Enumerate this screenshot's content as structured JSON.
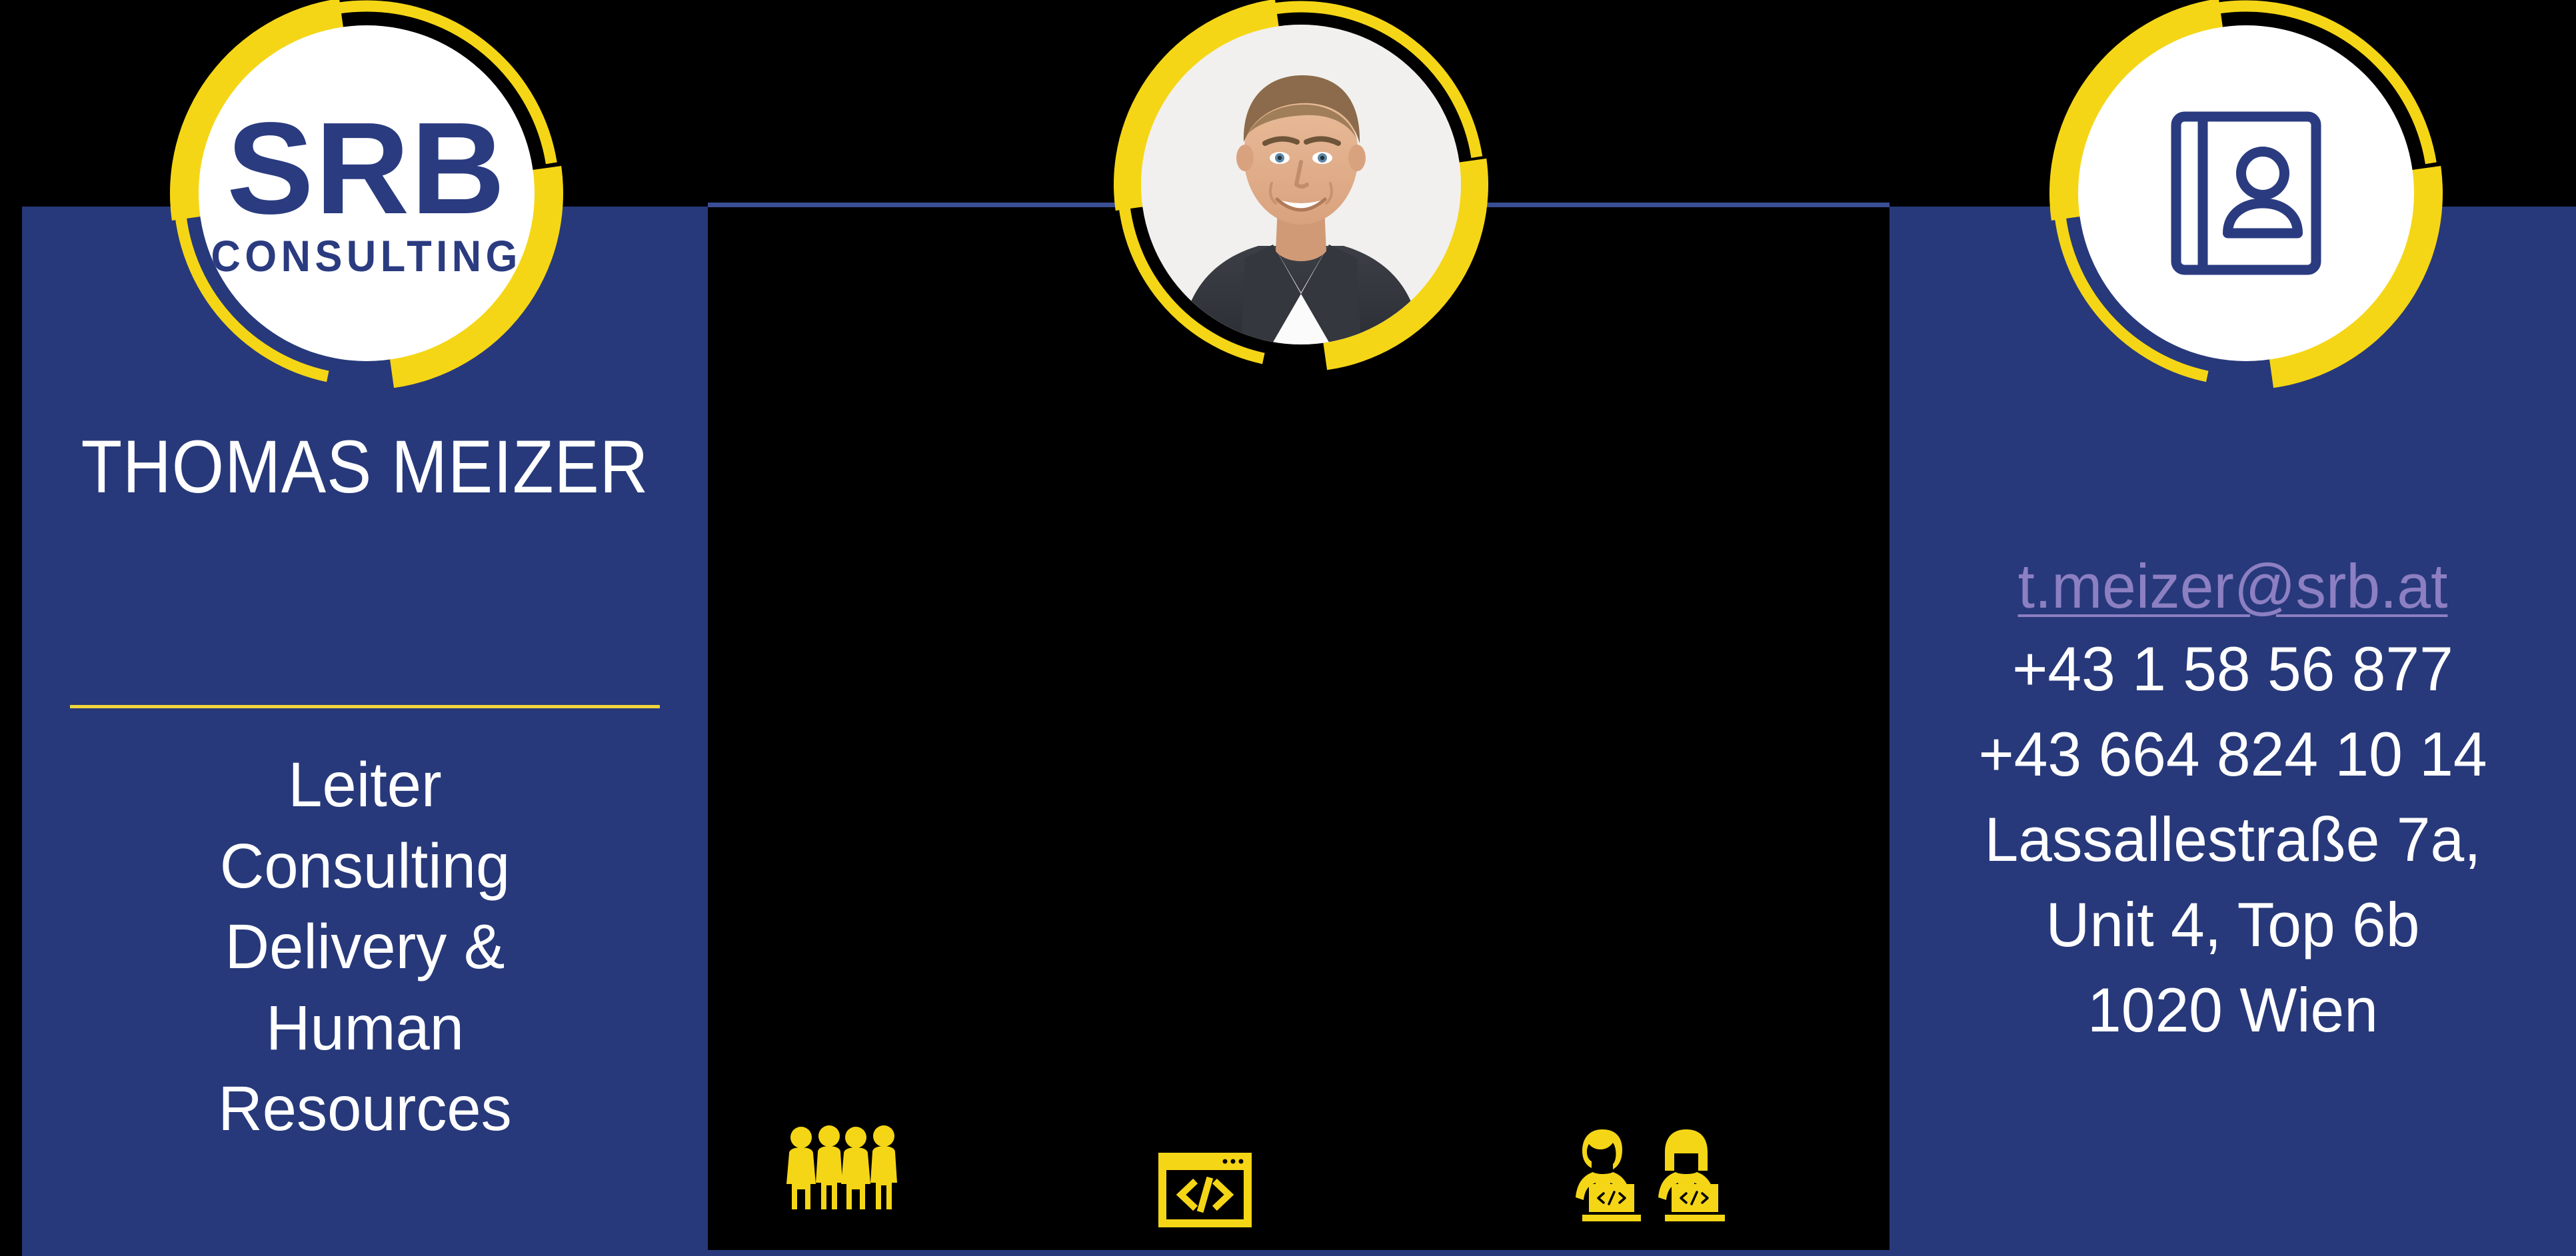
{
  "brand": {
    "logo_primary": "SRB",
    "logo_secondary": "CONSULTING",
    "accent_yellow": "#F5D616",
    "accent_blue": "#27397A",
    "logo_blue": "#2A3B80",
    "link_purple": "#8C7FC2",
    "divider_yellow": "#EFD63C",
    "background": "#000000"
  },
  "left_panel": {
    "person_name": "THOMAS MEIZER",
    "role_lines": [
      "Leiter",
      "Consulting",
      "Delivery &",
      "Human",
      "Resources"
    ],
    "role_text": "Leiter Consulting Delivery & Human Resources",
    "logo_icon": "srb-consulting-logo",
    "divider": "yellow-divider-rule"
  },
  "center_panel": {
    "portrait_icon": "portrait-photo",
    "portrait_alt": "Thomas Meizer portrait",
    "icons": [
      {
        "name": "team-group-icon",
        "label": "Team"
      },
      {
        "name": "code-window-icon",
        "label": "Code"
      },
      {
        "name": "developers-at-laptops-icon",
        "label": "Developers"
      }
    ]
  },
  "right_panel": {
    "header_icon": "contact-book-icon",
    "email": "t.meizer@srb.at",
    "phone_office": "+43 1 58 56 877",
    "phone_mobile": "+43 664 824 10 14",
    "address_line_1": "Lassallestraße 7a,",
    "address_line_2": "Unit 4, Top 6b",
    "address_line_3": "1020 Wien"
  }
}
